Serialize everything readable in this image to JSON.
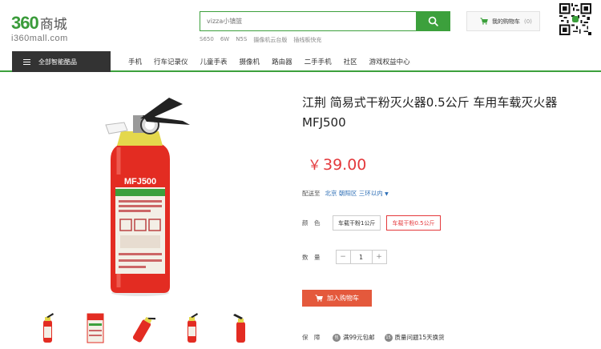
{
  "logo": {
    "main": "360",
    "main_cn": "商城",
    "sub": "i360mall.com"
  },
  "search": {
    "placeholder": "vizza小镇篮",
    "hot_words": [
      "S650",
      "6W",
      "N5S",
      "摄像机云台版",
      "插线板快充"
    ]
  },
  "cart": {
    "label": "我的购物车",
    "count": "(0)"
  },
  "nav": {
    "all_label": "全部智能酷品",
    "items": [
      "手机",
      "行车记录仪",
      "儿童手表",
      "摄像机",
      "路由器",
      "二手手机",
      "社区",
      "游戏权益中心"
    ]
  },
  "product": {
    "title": "江荆 简易式干粉灭火器0.5公斤 车用车载灭火器MFJ500",
    "price_symbol": "￥",
    "price": "39.00",
    "extinguisher_label": "MFJ500",
    "deliver_label": "配送至",
    "deliver_location": "北京 朝阳区 三环以内",
    "color_label": "颜　色",
    "specs": [
      "车载干粉1公斤",
      "车载干粉0.5公斤"
    ],
    "quantity_label": "数　量",
    "quantity": "1",
    "add_to_cart": "加入购物车",
    "guarantee_label": "保　障",
    "guarantee_items": [
      {
        "badge": "包",
        "text": "满99元包邮"
      },
      {
        "badge": "15",
        "text": "质量问题15天换货"
      }
    ]
  },
  "colors": {
    "accent": "#3ca03c",
    "price": "#e4393c",
    "cart_button": "#e4593c",
    "link": "#2b6db5"
  }
}
